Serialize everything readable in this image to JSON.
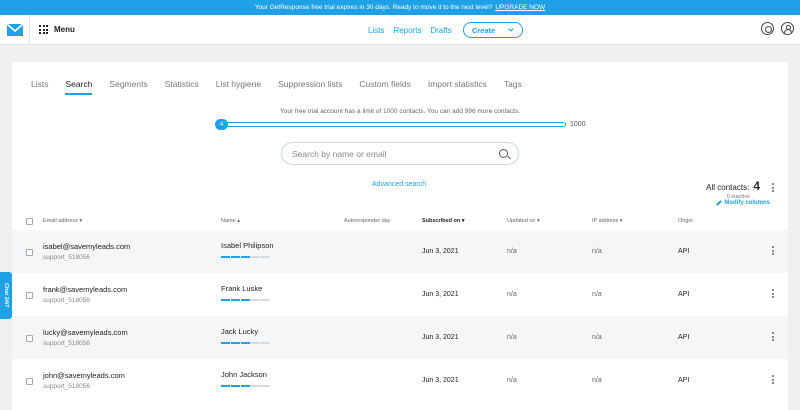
{
  "banner": {
    "text": "Your GetResponse free trial expires in 30 days. Ready to move it to the next level?",
    "link": "UPGRADE NOW"
  },
  "topbar": {
    "menu_label": "Menu",
    "nav": [
      "Lists",
      "Reports",
      "Drafts"
    ],
    "create_label": "Create"
  },
  "tabs": [
    {
      "label": "Lists",
      "active": false
    },
    {
      "label": "Search",
      "active": true
    },
    {
      "label": "Segments",
      "active": false
    },
    {
      "label": "Statistics",
      "active": false
    },
    {
      "label": "List hygiene",
      "active": false
    },
    {
      "label": "Suppression lists",
      "active": false
    },
    {
      "label": "Custom fields",
      "active": false
    },
    {
      "label": "Import statistics",
      "active": false
    },
    {
      "label": "Tags",
      "active": false
    }
  ],
  "trial": {
    "text": "Your free trial account has a limit of 1000 contacts. You can add 996 more contacts.",
    "current": "4",
    "max": "1000",
    "fill_fraction": 0.004
  },
  "search": {
    "placeholder": "Search by name or email"
  },
  "advanced_search": "Advanced search",
  "summary": {
    "label": "All contacts:",
    "count": "4",
    "inactive": "0 inactive",
    "modify": "Modify columns"
  },
  "columns": {
    "email": "Email address",
    "name": "Name",
    "autoresponder": "Autoresponder day",
    "subscribed": "Subscribed on",
    "updated": "Updated on",
    "ip": "IP address",
    "origin": "Origin"
  },
  "colors": {
    "accent": "#1ea1e6"
  },
  "rows": [
    {
      "email": "isabel@savemyleads.com",
      "sub": "support_518056",
      "name": "Isabel Philipson",
      "date": "Jun 3, 2021",
      "updated": "n/a",
      "ip": "n/a",
      "origin": "API",
      "engagement": 3
    },
    {
      "email": "frank@savemyleads.com",
      "sub": "support_518056",
      "name": "Frank Luske",
      "date": "Jun 3, 2021",
      "updated": "n/a",
      "ip": "n/a",
      "origin": "API",
      "engagement": 3
    },
    {
      "email": "lucky@savemyleads.com",
      "sub": "support_518056",
      "name": "Jack Lucky",
      "date": "Jun 3, 2021",
      "updated": "n/a",
      "ip": "n/a",
      "origin": "API",
      "engagement": 3
    },
    {
      "email": "john@savemyleads.com",
      "sub": "support_518056",
      "name": "John Jackson",
      "date": "Jun 3, 2021",
      "updated": "n/a",
      "ip": "n/a",
      "origin": "API",
      "engagement": 3
    }
  ],
  "chat_label": "Chat 24/7"
}
